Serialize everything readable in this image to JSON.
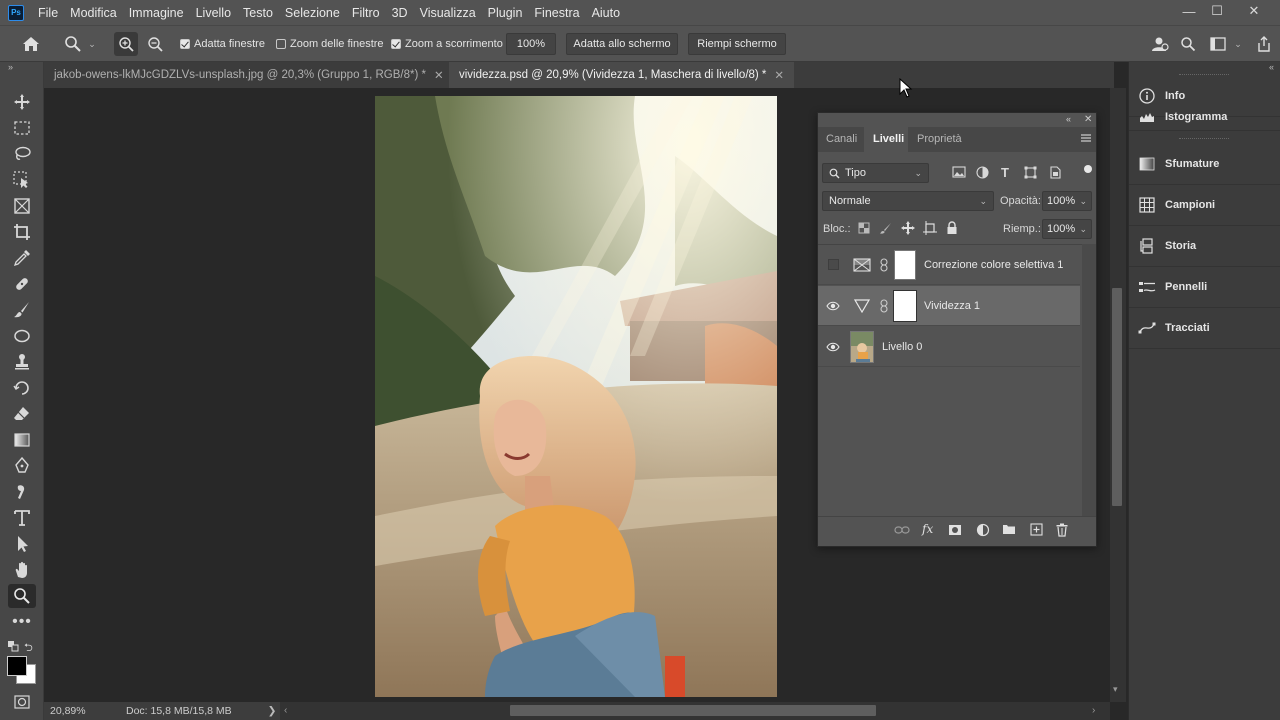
{
  "app": {
    "logo": "Ps"
  },
  "menu": [
    "File",
    "Modifica",
    "Immagine",
    "Livello",
    "Testo",
    "Selezione",
    "Filtro",
    "3D",
    "Visualizza",
    "Plugin",
    "Finestra",
    "Aiuto"
  ],
  "window_controls": {
    "minimize": "—",
    "maximize": "☐",
    "close": "✕"
  },
  "options": {
    "adatta_finestre": "Adatta finestre",
    "zoom_delle_finestre": "Zoom delle finestre",
    "zoom_a_scorrimento": "Zoom a scorrimento",
    "zoom_value": "100%",
    "adatta_schermo": "Adatta allo schermo",
    "riempi_schermo": "Riempi schermo",
    "checks": {
      "adatta_finestre": true,
      "zoom_delle_finestre": false,
      "zoom_a_scorrimento": true
    }
  },
  "tabs": [
    {
      "label": "jakob-owens-lkMJcGDZLVs-unsplash.jpg @ 20,3% (Gruppo 1, RGB/8*) *",
      "active": false
    },
    {
      "label": "vividezza.psd @ 20,9% (Vividezza 1, Maschera di livello/8) *",
      "active": true
    }
  ],
  "layers_panel": {
    "tabs": [
      "Canali",
      "Livelli",
      "Proprietà"
    ],
    "active_tab": "Livelli",
    "filter": "Tipo",
    "blend_mode": "Normale",
    "opacity_label": "Opacità:",
    "opacity": "100%",
    "lock_label": "Bloc.:",
    "fill_label": "Riemp.:",
    "fill": "100%",
    "layers": [
      {
        "name": "Correzione colore selettiva 1",
        "visible": false,
        "selected": false
      },
      {
        "name": "Vividezza 1",
        "visible": true,
        "selected": true
      },
      {
        "name": "Livello 0",
        "visible": true,
        "selected": false
      }
    ]
  },
  "right_dock": [
    "Info",
    "Istogramma",
    "Sfumature",
    "Campioni",
    "Storia",
    "Pennelli",
    "Tracciati"
  ],
  "status": {
    "zoom": "20,89%",
    "doc": "Doc: 15,8 MB/15,8 MB",
    "arrow": "❯"
  },
  "colors": {
    "menubar": "#535353",
    "workspace": "#282828",
    "panel": "#535353",
    "accent": "#31a8ff"
  }
}
